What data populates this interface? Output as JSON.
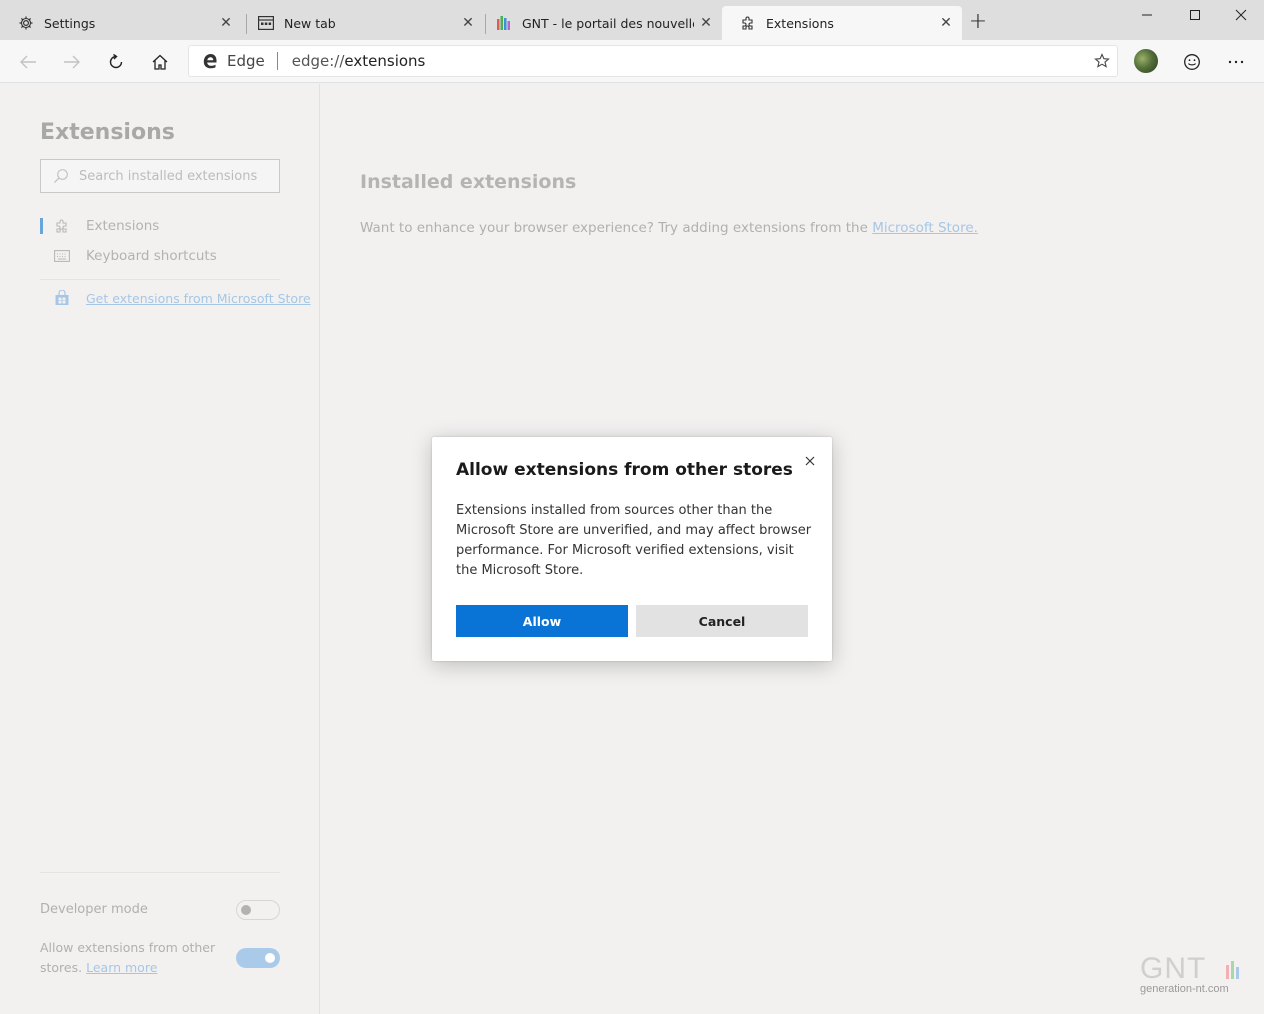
{
  "tabs": [
    {
      "title": "Settings",
      "icon": "gear-icon",
      "active": false
    },
    {
      "title": "New tab",
      "icon": "newtab-icon",
      "active": false
    },
    {
      "title": "GNT - le portail des nouvelles te",
      "icon": "gnt-favicon-icon",
      "active": false
    },
    {
      "title": "Extensions",
      "icon": "puzzle-icon",
      "active": true
    }
  ],
  "address_bar": {
    "brand_label": "Edge",
    "url_scheme": "edge://",
    "url_path": "extensions"
  },
  "sidebar": {
    "title": "Extensions",
    "search_placeholder": "Search installed extensions",
    "nav": [
      {
        "label": "Extensions",
        "icon": "puzzle-icon",
        "selected": true
      },
      {
        "label": "Keyboard shortcuts",
        "icon": "keyboard-icon",
        "selected": false
      }
    ],
    "store_link": "Get extensions from Microsoft Store",
    "developer_mode_label": "Developer mode",
    "developer_mode_on": false,
    "allow_other_stores_label": "Allow extensions from other stores.",
    "allow_other_stores_learn_more": "Learn more",
    "allow_other_stores_on": true
  },
  "main": {
    "heading": "Installed extensions",
    "empty_text": "Want to enhance your browser experience? Try adding extensions from the",
    "store_link": "Microsoft Store."
  },
  "dialog": {
    "title": "Allow extensions from other stores",
    "body": "Extensions installed from sources other than the Microsoft Store are unverified, and may affect browser performance. For Microsoft verified extensions, visit the Microsoft Store.",
    "allow_label": "Allow",
    "cancel_label": "Cancel"
  },
  "watermark": {
    "logo": "GNT",
    "site": "generation-nt.com"
  },
  "colors": {
    "accent": "#0a74d6",
    "link": "#a6c6e5",
    "toggle_on": "#a9cbe9"
  }
}
